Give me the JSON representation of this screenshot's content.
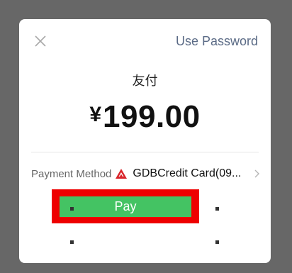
{
  "dialog": {
    "use_password_label": "Use Password",
    "title": "友付",
    "currency_symbol": "¥",
    "amount": "199.00",
    "payment_method_label": "Payment Method",
    "payment_method_value": "GDBCredit Card(09...",
    "pay_label": "Pay"
  },
  "icons": {
    "close": "close-icon",
    "bank": "bank-logo-icon",
    "chevron": "chevron-right-icon"
  },
  "colors": {
    "accent": "#5b6b86",
    "pay_button": "#44c363",
    "highlight_outline": "#ee0000",
    "bank_logo": "#d9252b"
  }
}
